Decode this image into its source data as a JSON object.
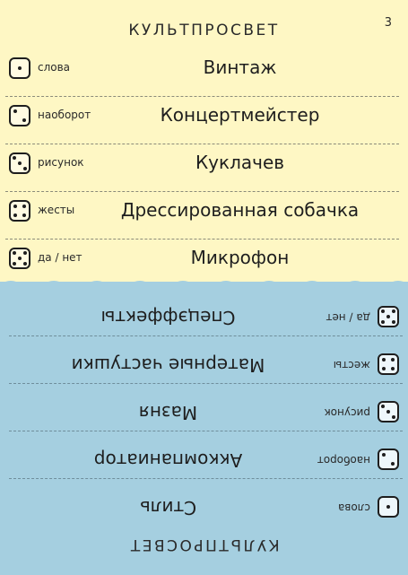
{
  "page_number": "3",
  "top_card": {
    "category": "КУЛЬТПРОСВЕТ",
    "rows": [
      {
        "mode": "слова",
        "pips": 1,
        "word": "Винтаж"
      },
      {
        "mode": "наоборот",
        "pips": 2,
        "word": "Концертмейстер"
      },
      {
        "mode": "рисунок",
        "pips": 3,
        "word": "Куклачев"
      },
      {
        "mode": "жесты",
        "pips": 4,
        "word": "Дрессированная собачка"
      },
      {
        "mode": "да / нет",
        "pips": 5,
        "word": "Микрофон"
      }
    ]
  },
  "bottom_card": {
    "category": "КУЛЬТПРОСВЕТ",
    "rows": [
      {
        "mode": "слова",
        "pips": 1,
        "word": "Стиль"
      },
      {
        "mode": "наоборот",
        "pips": 2,
        "word": "Аккомпаниатор"
      },
      {
        "mode": "рисунок",
        "pips": 3,
        "word": "Мазня"
      },
      {
        "mode": "жесты",
        "pips": 4,
        "word": "Матерные частушки"
      },
      {
        "mode": "да / нет",
        "pips": 5,
        "word": "Спецэффекты"
      }
    ]
  },
  "colors": {
    "top_background": "#fef7c4",
    "bottom_background": "#a5cfe0",
    "ink": "#1e1e1e"
  }
}
